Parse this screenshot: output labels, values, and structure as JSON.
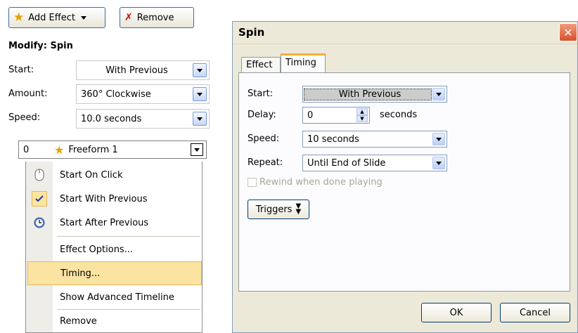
{
  "task_pane": {
    "add_effect_label": "Add Effect",
    "remove_label": "Remove",
    "section_title": "Modify: Spin",
    "start": {
      "label": "Start:",
      "value": "With Previous"
    },
    "amount": {
      "label": "Amount:",
      "value": "360° Clockwise"
    },
    "speed": {
      "label": "Speed:",
      "value": "10.0 seconds"
    },
    "effect_item": {
      "order": "0",
      "name": "Freeform 1"
    },
    "menu": {
      "start_on_click": "Start On Click",
      "start_with_previous": "Start With Previous",
      "start_after_previous": "Start After Previous",
      "effect_options": "Effect Options...",
      "timing": "Timing...",
      "show_advanced_timeline": "Show Advanced Timeline",
      "remove": "Remove"
    }
  },
  "dialog": {
    "title": "Spin",
    "tabs": [
      "Effect",
      "Timing"
    ],
    "active_tab": "Timing",
    "start": {
      "label": "Start:",
      "value": "With Previous"
    },
    "delay": {
      "label": "Delay:",
      "value": "0",
      "unit": "seconds"
    },
    "speed": {
      "label": "Speed:",
      "value": "10 seconds"
    },
    "repeat": {
      "label": "Repeat:",
      "value": "Until End of Slide"
    },
    "rewind_label": "Rewind when done playing",
    "triggers_label": "Triggers",
    "ok_label": "OK",
    "cancel_label": "Cancel"
  },
  "colors": {
    "dialog_bg": "#ece9d8",
    "menu_highlight": "#fbe3a2",
    "close_button": "#d8502a",
    "active_tab_accent": "#f5b03e"
  }
}
